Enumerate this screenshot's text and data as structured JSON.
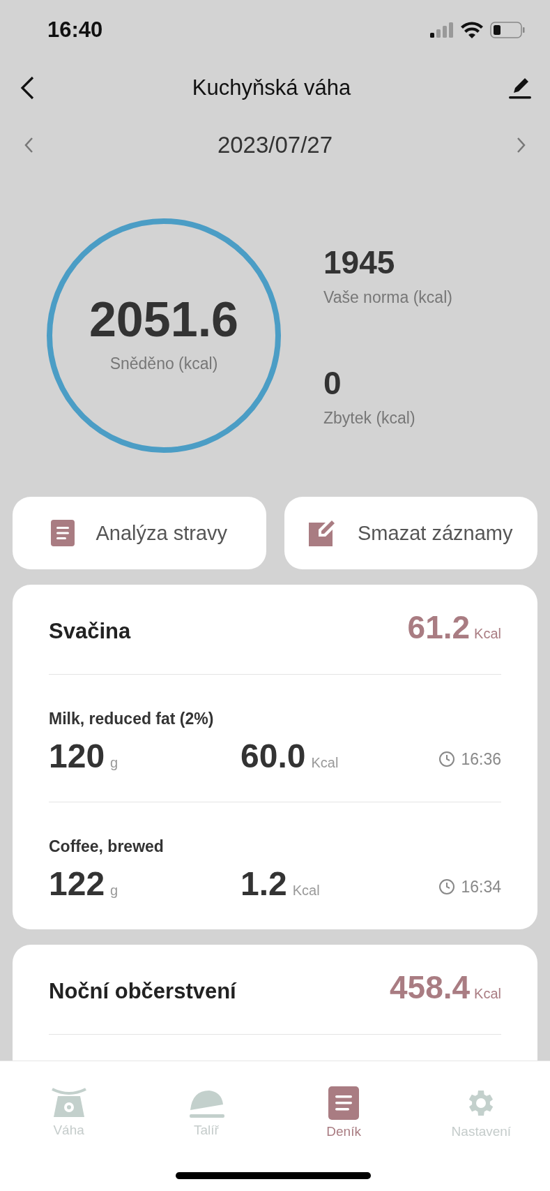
{
  "status_bar": {
    "time": "16:40"
  },
  "header": {
    "title": "Kuchyňská váha"
  },
  "date_nav": {
    "date": "2023/07/27"
  },
  "summary": {
    "eaten": "2051.6",
    "eaten_label": "Sněděno (kcal)",
    "norm": "1945",
    "norm_label": "Vaše norma (kcal)",
    "remaining": "0",
    "remaining_label": "Zbytek (kcal)"
  },
  "actions": [
    {
      "label": "Analýza stravy",
      "kind": "document"
    },
    {
      "label": "Smazat záznamy",
      "kind": "edit"
    }
  ],
  "meals": [
    {
      "name": "Svačina",
      "total": "61.2",
      "unit": "Kcal",
      "items": [
        {
          "name": "Milk, reduced fat (2%)",
          "weight": "120",
          "weight_unit": "g",
          "energy": "60.0",
          "energy_unit": "Kcal",
          "time": "16:36"
        },
        {
          "name": "Coffee, brewed",
          "weight": "122",
          "weight_unit": "g",
          "energy": "1.2",
          "energy_unit": "Kcal",
          "time": "16:34"
        }
      ]
    },
    {
      "name": "Noční občerstvení",
      "total": "458.4",
      "unit": "Kcal"
    }
  ],
  "tabs": [
    {
      "label": "Váha",
      "kind": "scale",
      "selected": false
    },
    {
      "label": "Talíř",
      "kind": "cloche",
      "selected": false
    },
    {
      "label": "Deník",
      "kind": "diary",
      "selected": true
    },
    {
      "label": "Nastavení",
      "kind": "settings",
      "selected": false
    }
  ]
}
